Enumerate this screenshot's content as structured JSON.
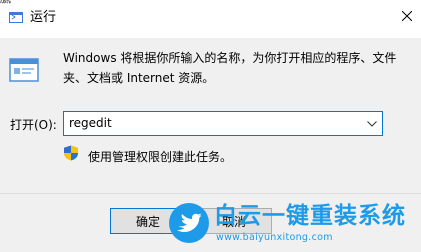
{
  "window": {
    "top_fragment": "腻",
    "title": "运行",
    "description": "Windows 将根据你所输入的名称，为你打开相应的程序、文件夹、文档或 Internet 资源。",
    "open_label": "打开(O):",
    "input_value": "regedit",
    "admin_note": "使用管理权限创建此任务。",
    "ok_label": "确定",
    "cancel_label": "取消"
  },
  "watermark": {
    "title": "白云一键重装系统",
    "url": "www.baiyunxitong.com"
  },
  "colors": {
    "accent": "#0078d7",
    "watermark": "#1d9be8"
  }
}
